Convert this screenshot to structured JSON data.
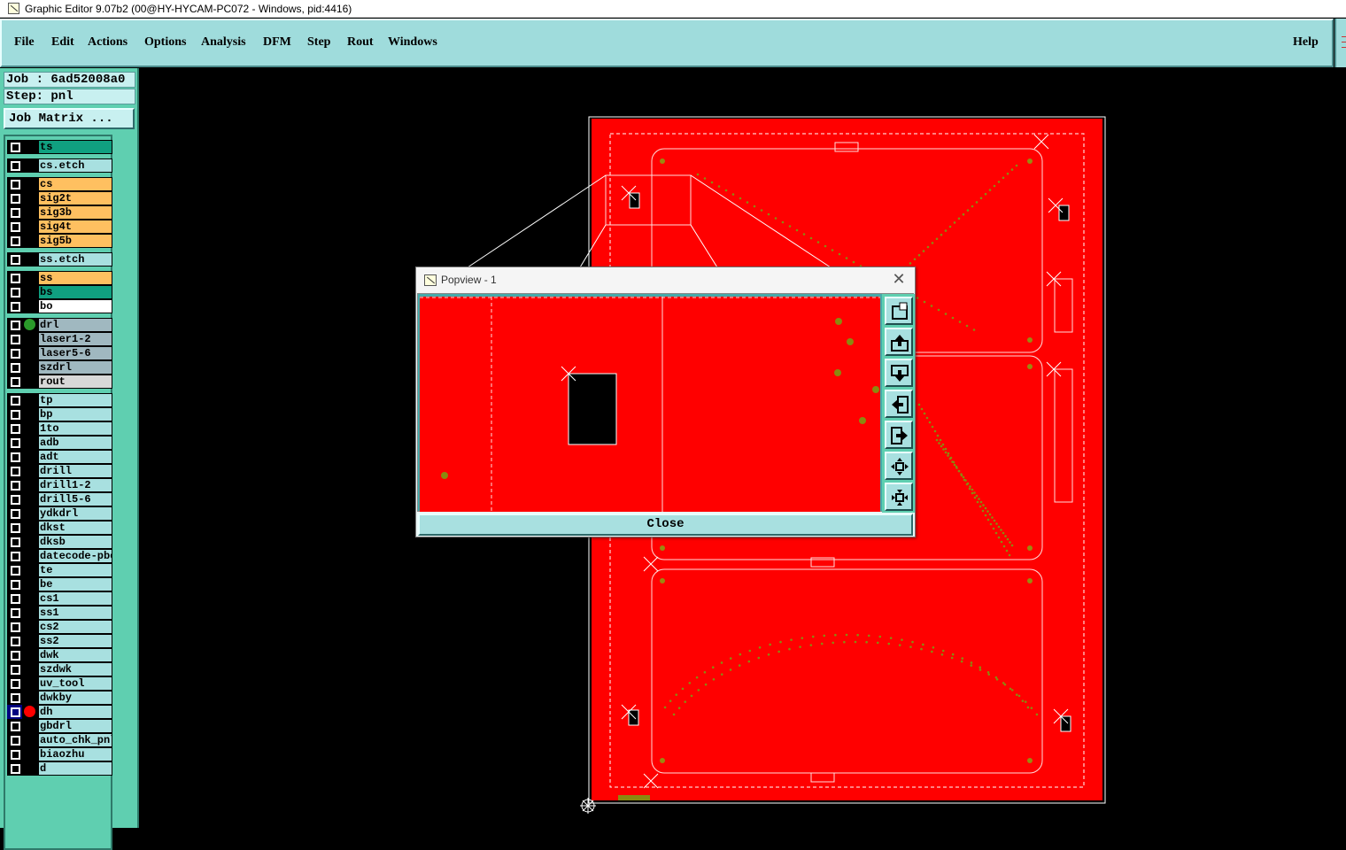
{
  "window": {
    "title": "Graphic Editor 9.07b2 (00@HY-HYCAM-PC072 - Windows, pid:4416)"
  },
  "menu": {
    "items": [
      {
        "label": "File"
      },
      {
        "label": "Edit"
      },
      {
        "label": "Actions"
      },
      {
        "label": "Options"
      },
      {
        "label": "Analysis"
      },
      {
        "label": "DFM"
      },
      {
        "label": "Step"
      },
      {
        "label": "Rout"
      },
      {
        "label": "Windows"
      }
    ],
    "help": "Help"
  },
  "job": {
    "job_label": "Job : 6ad52008a0",
    "step_label": "Step: pnl",
    "matrix_button": "Job Matrix ..."
  },
  "layers": [
    {
      "name": "ts",
      "color": "#10a080",
      "group": 0
    },
    {
      "name": "cs.etch",
      "color": "#a8e0e0",
      "group": 1
    },
    {
      "name": "cs",
      "color": "#ffc060",
      "group": 2
    },
    {
      "name": "sig2t",
      "color": "#ffc060",
      "group": 2
    },
    {
      "name": "sig3b",
      "color": "#ffc060",
      "group": 2
    },
    {
      "name": "sig4t",
      "color": "#ffc060",
      "group": 2
    },
    {
      "name": "sig5b",
      "color": "#ffc060",
      "group": 2
    },
    {
      "name": "ss.etch",
      "color": "#a8e0e0",
      "group": 3
    },
    {
      "name": "ss",
      "color": "#ffc060",
      "group": 4
    },
    {
      "name": "bs",
      "color": "#10a080",
      "group": 4
    },
    {
      "name": "bo",
      "color": "#ffffff",
      "group": 4
    },
    {
      "name": "drl",
      "color": "#a0b8c0",
      "group": 5,
      "dot": "#2a9a2a"
    },
    {
      "name": "laser1-2",
      "color": "#a0b8c0",
      "group": 5
    },
    {
      "name": "laser5-6",
      "color": "#a0b8c0",
      "group": 5
    },
    {
      "name": "szdrl",
      "color": "#a0b8c0",
      "group": 5
    },
    {
      "name": "rout",
      "color": "#d8d8d8",
      "group": 5
    },
    {
      "name": "tp",
      "color": "#a8e0e0",
      "group": 6
    },
    {
      "name": "bp",
      "color": "#a8e0e0",
      "group": 6
    },
    {
      "name": "1to",
      "color": "#a8e0e0",
      "group": 6
    },
    {
      "name": "adb",
      "color": "#a8e0e0",
      "group": 6
    },
    {
      "name": "adt",
      "color": "#a8e0e0",
      "group": 6
    },
    {
      "name": "drill",
      "color": "#a8e0e0",
      "group": 6
    },
    {
      "name": "drill1-2",
      "color": "#a8e0e0",
      "group": 6
    },
    {
      "name": "drill5-6",
      "color": "#a8e0e0",
      "group": 6
    },
    {
      "name": "ydkdrl",
      "color": "#a8e0e0",
      "group": 6
    },
    {
      "name": "dkst",
      "color": "#a8e0e0",
      "group": 6
    },
    {
      "name": "dksb",
      "color": "#a8e0e0",
      "group": 6
    },
    {
      "name": "datecode-pbe",
      "color": "#a8e0e0",
      "group": 6
    },
    {
      "name": "te",
      "color": "#a8e0e0",
      "group": 6
    },
    {
      "name": "be",
      "color": "#a8e0e0",
      "group": 6
    },
    {
      "name": "cs1",
      "color": "#a8e0e0",
      "group": 6
    },
    {
      "name": "ss1",
      "color": "#a8e0e0",
      "group": 6
    },
    {
      "name": "cs2",
      "color": "#a8e0e0",
      "group": 6
    },
    {
      "name": "ss2",
      "color": "#a8e0e0",
      "group": 6
    },
    {
      "name": "dwk",
      "color": "#a8e0e0",
      "group": 6
    },
    {
      "name": "szdwk",
      "color": "#a8e0e0",
      "group": 6
    },
    {
      "name": "uv_tool",
      "color": "#a8e0e0",
      "group": 6
    },
    {
      "name": "dwkby",
      "color": "#a8e0e0",
      "group": 6
    },
    {
      "name": "dh",
      "color": "#a8e0e0",
      "group": 6,
      "dot": "#ff0000",
      "active": true
    },
    {
      "name": "gbdrl",
      "color": "#a8e0e0",
      "group": 6
    },
    {
      "name": "auto_chk_pnl",
      "color": "#a8e0e0",
      "group": 6
    },
    {
      "name": "biaozhu",
      "color": "#a8e0e0",
      "group": 6
    },
    {
      "name": "d",
      "color": "#a8e0e0",
      "group": 6
    }
  ],
  "popview": {
    "title": "Popview - 1",
    "close_button": "Close",
    "tool_icons": [
      "zoom-fit-icon",
      "pan-up-icon",
      "pan-down-icon",
      "pan-left-icon",
      "pan-right-icon",
      "zoom-out-icon",
      "zoom-in-icon"
    ]
  },
  "colors": {
    "board": "#ff0000",
    "outline": "#ffffff",
    "pad": "#8a8a10",
    "menu_bg": "#9fdcdc",
    "panel_bg": "#5fcfb0"
  }
}
